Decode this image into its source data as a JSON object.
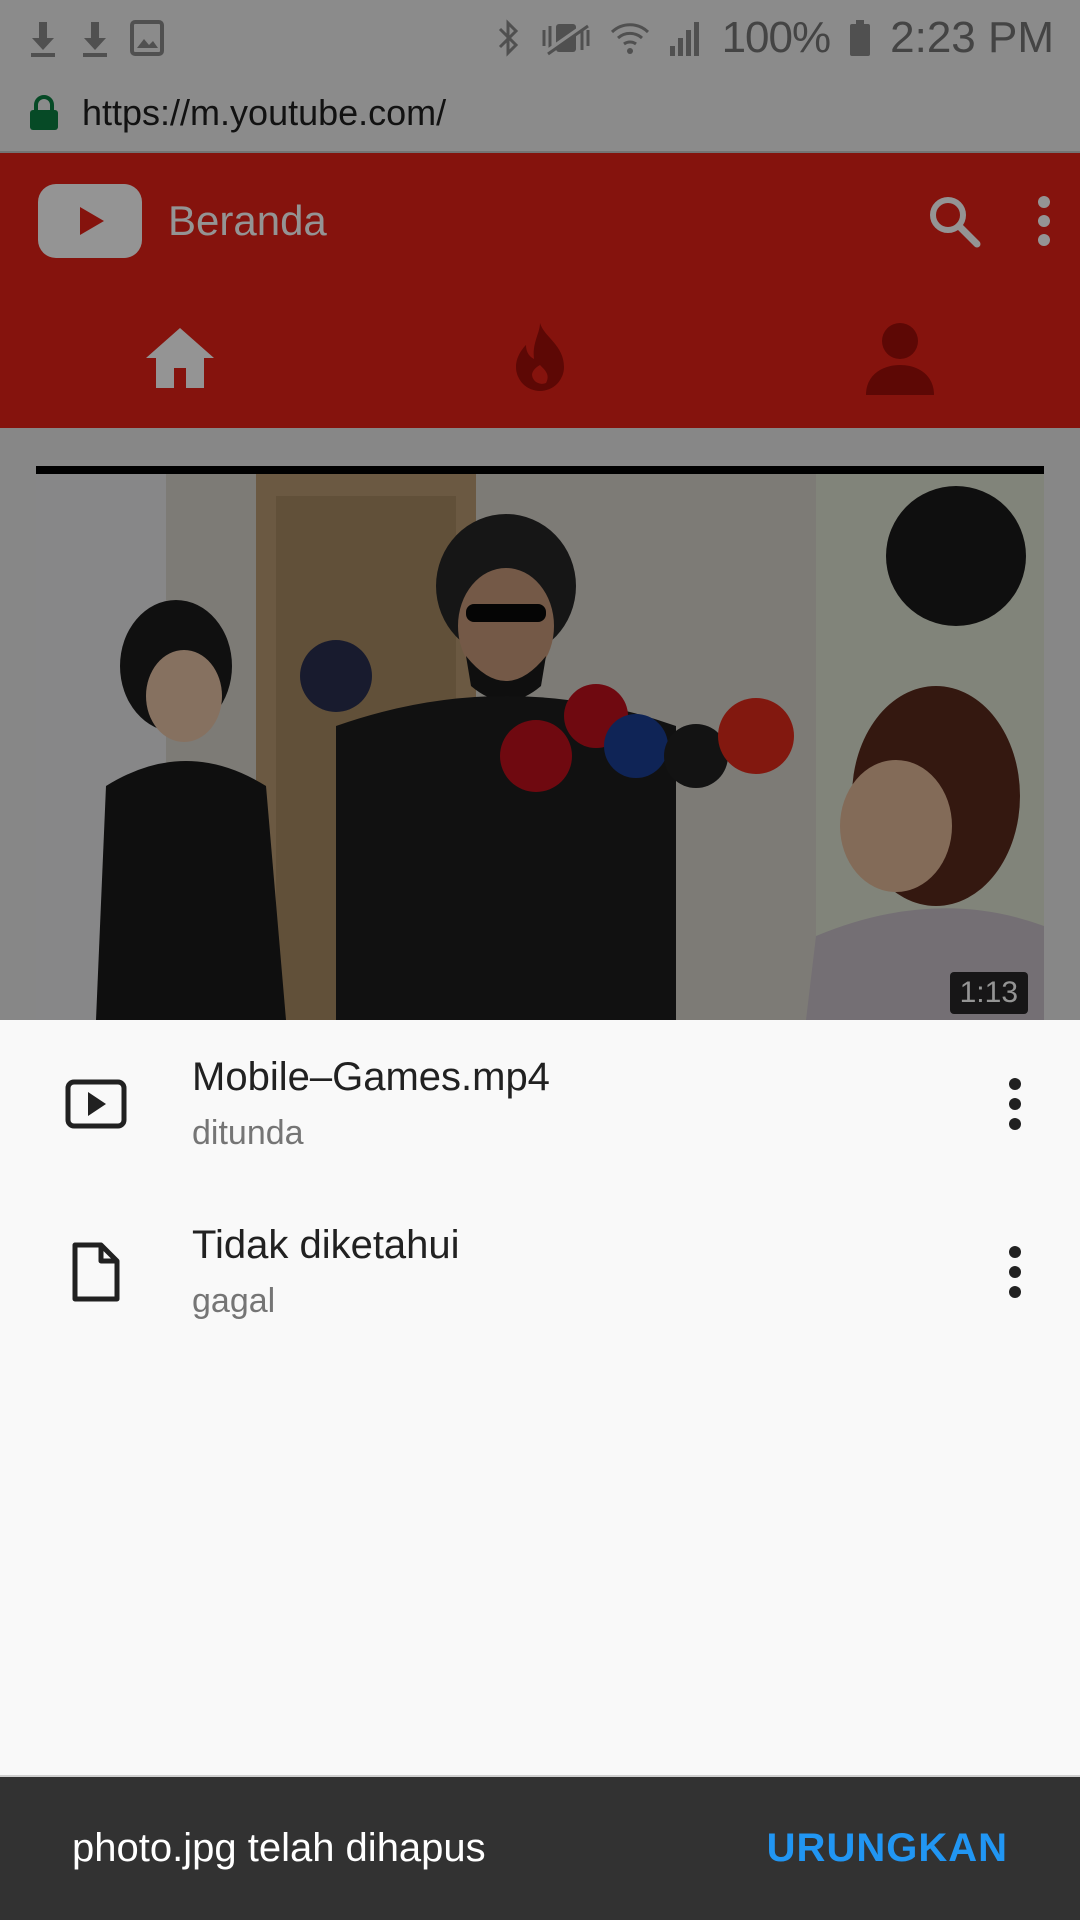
{
  "status_bar": {
    "battery": "100%",
    "time": "2:23 PM",
    "icons": [
      "download-icon",
      "download-icon",
      "image-icon",
      "bluetooth-icon",
      "vibrate-icon",
      "wifi-icon",
      "signal-icon",
      "battery-icon"
    ]
  },
  "browser": {
    "url": "https://m.youtube.com/"
  },
  "youtube": {
    "title": "Beranda",
    "tabs": [
      "home-icon",
      "trending-icon",
      "account-icon"
    ],
    "video": {
      "duration": "1:13"
    }
  },
  "downloads": [
    {
      "name": "Mobile–Games.mp4",
      "status": "ditunda",
      "icon": "video-file-icon"
    },
    {
      "name": "Tidak diketahui",
      "status": "gagal",
      "icon": "file-icon"
    }
  ],
  "snackbar": {
    "message": "photo.jpg telah dihapus",
    "action": "URUNGKAN"
  },
  "colors": {
    "youtube_red": "#e62117",
    "snackbar_bg": "#323232",
    "snackbar_action": "#2196f3",
    "lock_green": "#0b8043"
  }
}
